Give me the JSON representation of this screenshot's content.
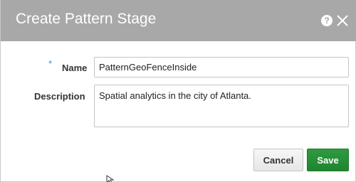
{
  "dialog": {
    "title": "Create Pattern Stage",
    "help_glyph": "?",
    "help_icon": "help-icon",
    "close_icon": "close-icon"
  },
  "form": {
    "required_marker": "*",
    "name_label": "Name",
    "name_value": "PatternGeoFenceInside",
    "description_label": "Description",
    "description_value": "Spatial analytics in the city of Atlanta."
  },
  "buttons": {
    "cancel_label": "Cancel",
    "save_label": "Save"
  },
  "colors": {
    "titlebar": "#a8a8a8",
    "save_button": "#1f8530",
    "required_marker": "#4a90c8"
  }
}
